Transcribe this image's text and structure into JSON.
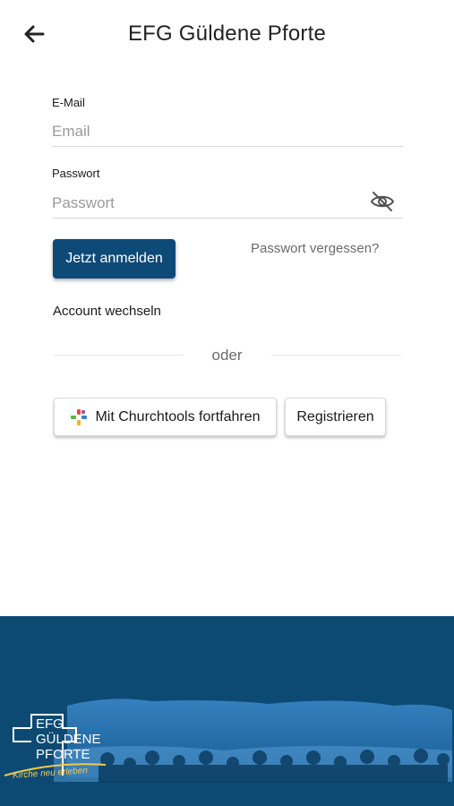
{
  "header": {
    "title": "EFG Güldene Pforte",
    "back_icon": "arrow-left-icon"
  },
  "form": {
    "email": {
      "label": "E-Mail",
      "placeholder": "Email",
      "value": ""
    },
    "password": {
      "label": "Passwort",
      "placeholder": "Passwort",
      "value": "",
      "toggle_icon": "eye-off-icon"
    },
    "login_button": "Jetzt anmelden",
    "forgot_password": "Passwort vergessen?",
    "switch_account": "Account wechseln",
    "divider_text": "oder"
  },
  "alt_actions": {
    "churchtools": {
      "label": "Mit Churchtools fortfahren",
      "icon": "churchtools-logo-icon"
    },
    "register": "Registrieren"
  },
  "footer": {
    "logo": {
      "line1": "EFG",
      "line2": "GÜLDENE",
      "line3": "PFORTE",
      "tagline": "Kirche neu erleben"
    }
  },
  "colors": {
    "primary": "#0e4a78",
    "footer_bg": "#0d4a73",
    "tagline": "#f2c84b"
  }
}
